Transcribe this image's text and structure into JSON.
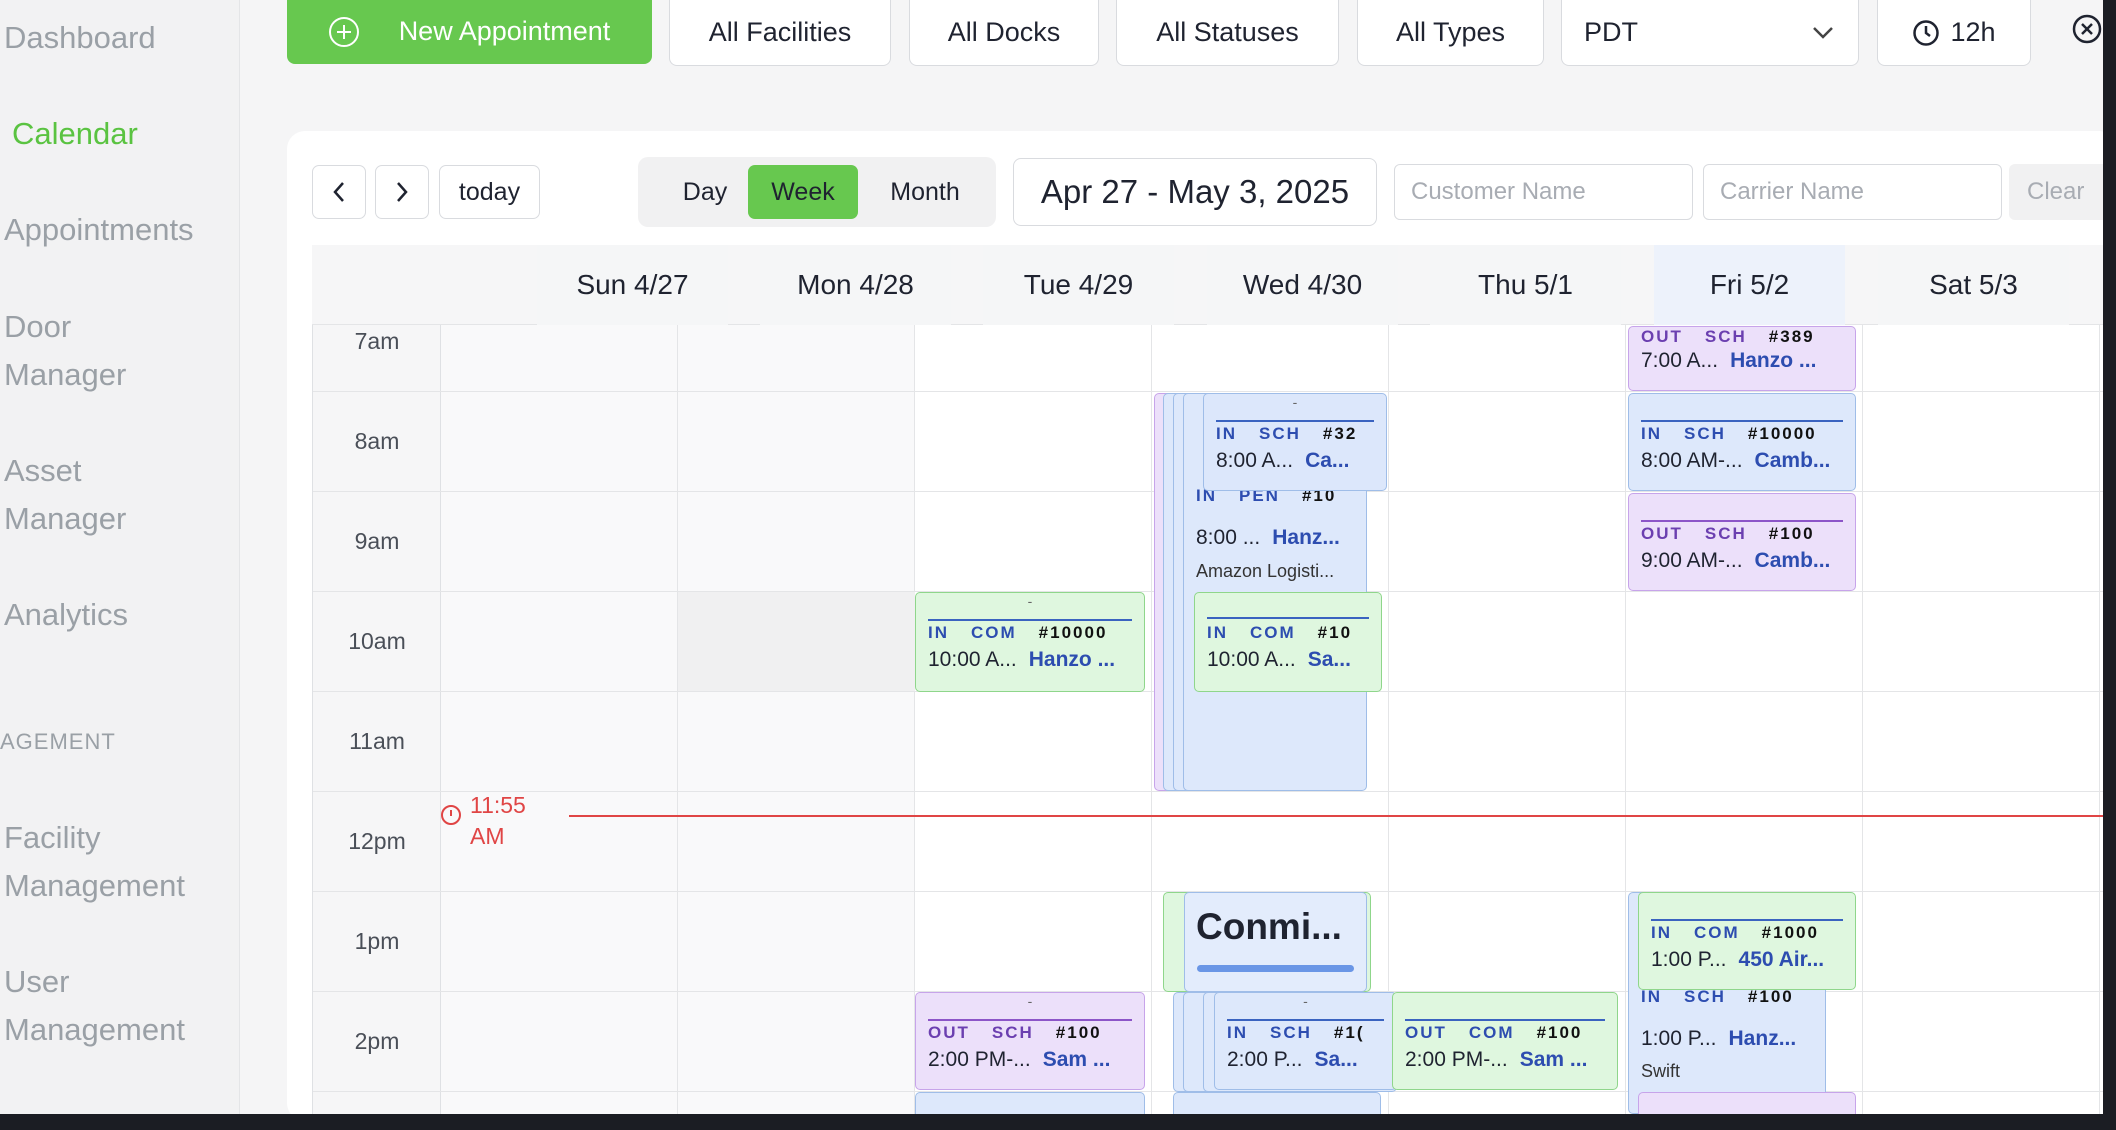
{
  "sidebar": {
    "items": [
      {
        "label": "Dashboard"
      },
      {
        "label": "Calendar"
      },
      {
        "label": "Appointments"
      },
      {
        "label": "Door"
      },
      {
        "label": "Manager"
      },
      {
        "label": "Asset"
      },
      {
        "label": "Manager"
      },
      {
        "label": "Analytics"
      },
      {
        "label": "Facility"
      },
      {
        "label": "Management"
      },
      {
        "label": "User"
      },
      {
        "label": "Management"
      }
    ],
    "section_label": "AGEMENT"
  },
  "toolbar": {
    "new_appointment": "New Appointment",
    "facilities": "All Facilities",
    "docks": "All Docks",
    "statuses": "All Statuses",
    "types": "All Types",
    "timezone": "PDT",
    "hours": "12h"
  },
  "calendar": {
    "today_label": "today",
    "views": [
      "Day",
      "Week",
      "Month"
    ],
    "active_view": "Week",
    "date_range": "Apr 27 - May 3, 2025",
    "customer_placeholder": "Customer Name",
    "carrier_placeholder": "Carrier Name",
    "clear_label": "Clear",
    "days": [
      "Sun 4/27",
      "Mon 4/28",
      "Tue 4/29",
      "Wed 4/30",
      "Thu 5/1",
      "Fri 5/2",
      "Sat 5/3"
    ],
    "hours": [
      "7am",
      "8am",
      "9am",
      "10am",
      "11am",
      "12pm",
      "1pm",
      "2pm"
    ],
    "now_label_line1": "11:55",
    "now_label_line2": "AM",
    "popover_title": "Conmi..."
  },
  "events": [
    {
      "id": "fri-7",
      "tags": [
        "OUT",
        "SCH",
        "#389"
      ],
      "time": "7:00 A...",
      "customer": "Hanzo ..."
    },
    {
      "id": "wed-8",
      "tags": [
        "IN",
        "SCH",
        "#32"
      ],
      "time": "8:00 A...",
      "customer": "Ca..."
    },
    {
      "id": "fri-8",
      "tags": [
        "IN",
        "SCH",
        "#10000"
      ],
      "time": "8:00 AM-...",
      "customer": "Camb..."
    },
    {
      "id": "wed-pen",
      "tags": [
        "IN",
        "PEN",
        "#10"
      ],
      "time": "8:00 ...",
      "customer": "Hanz...",
      "carrier": "Amazon Logisti..."
    },
    {
      "id": "fri-9",
      "tags": [
        "OUT",
        "SCH",
        "#100"
      ],
      "time": "9:00 AM-...",
      "customer": "Camb..."
    },
    {
      "id": "tue-10",
      "tags": [
        "IN",
        "COM",
        "#10000"
      ],
      "time": "10:00 A...",
      "customer": "Hanzo ..."
    },
    {
      "id": "wed-10",
      "tags": [
        "IN",
        "COM",
        "#10"
      ],
      "time": "10:00 A...",
      "customer": "Sa..."
    },
    {
      "id": "fri-13a",
      "tags": [
        "IN",
        "COM",
        "#1000"
      ],
      "time": "1:00 P...",
      "customer": "450 Air..."
    },
    {
      "id": "fri-13b",
      "tags": [
        "IN",
        "SCH",
        "#100"
      ],
      "time": "1:00 P...",
      "customer": "Hanz...",
      "carrier": "Swift"
    },
    {
      "id": "tue-14",
      "tags": [
        "OUT",
        "SCH",
        "#100"
      ],
      "time": "2:00 PM-...",
      "customer": "Sam ..."
    },
    {
      "id": "wed-14",
      "tags": [
        "IN",
        "SCH",
        "#1("
      ],
      "time": "2:00 P...",
      "customer": "Sa..."
    },
    {
      "id": "thu-14",
      "tags": [
        "OUT",
        "COM",
        "#100"
      ],
      "time": "2:00 PM-...",
      "customer": "Sam ..."
    }
  ],
  "colors": {
    "accent_green": "#67c84f",
    "now_red": "#e04545",
    "event_blue": "#dde8fb",
    "event_green": "#dff7df",
    "event_purple": "#ece0fa"
  }
}
